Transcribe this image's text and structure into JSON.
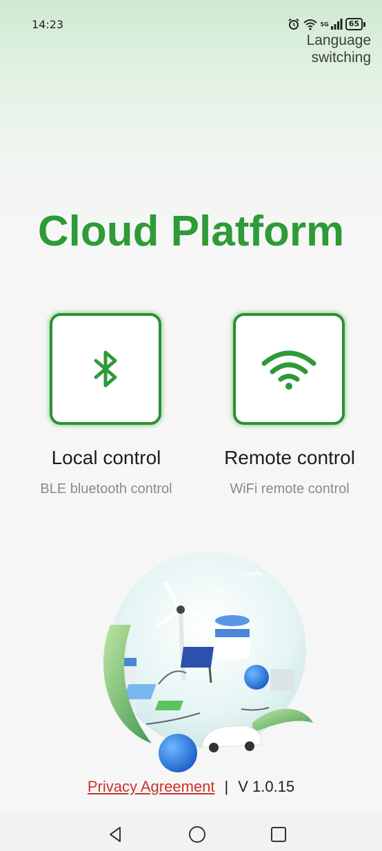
{
  "status_bar": {
    "time": "14:23",
    "icons": [
      "alarm-icon",
      "wifi-icon",
      "signal-icon"
    ],
    "network_label": "5G",
    "battery": "65"
  },
  "header": {
    "language_switch": "Language switching"
  },
  "title": "Cloud Platform",
  "controls": [
    {
      "icon": "bluetooth-icon",
      "label": "Local control",
      "sublabel": "BLE bluetooth control"
    },
    {
      "icon": "wifi-icon",
      "label": "Remote control",
      "sublabel": "WiFi remote control"
    }
  ],
  "footer": {
    "privacy": "Privacy Agreement",
    "separator": "|",
    "version": "V 1.0.15"
  },
  "nav": [
    "back-icon",
    "home-icon",
    "recent-apps-icon"
  ],
  "colors": {
    "brand_green": "#2e9a38",
    "card_border": "#2e8f34",
    "link_red": "#c8342b"
  }
}
